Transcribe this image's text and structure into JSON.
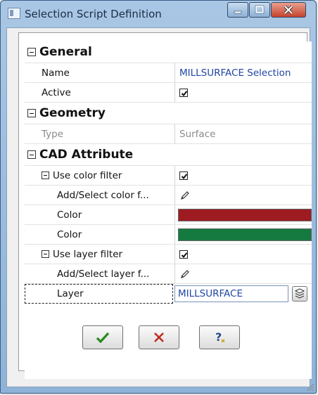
{
  "window": {
    "title": "Selection Script Definition"
  },
  "grid": {
    "rows": [
      {
        "label": "General",
        "kind": "category"
      },
      {
        "label": "Name",
        "value": "MILLSURFACE Selection",
        "kind": "text-link"
      },
      {
        "label": "Active",
        "value": true,
        "kind": "checkbox"
      },
      {
        "label": "Geometry",
        "kind": "category"
      },
      {
        "label": "Type",
        "value": "Surface",
        "kind": "text-grey"
      },
      {
        "label": "CAD Attribute",
        "kind": "category"
      },
      {
        "label": "Use color filter",
        "value": true,
        "kind": "checkbox-group"
      },
      {
        "label": "Add/Select color f...",
        "kind": "pencil"
      },
      {
        "label": "Color",
        "value": "#9e1b21",
        "kind": "color"
      },
      {
        "label": "Color",
        "value": "#157a3f",
        "kind": "color"
      },
      {
        "label": "Use layer filter",
        "value": true,
        "kind": "checkbox-group"
      },
      {
        "label": "Add/Select layer f...",
        "kind": "pencil"
      },
      {
        "label": "Layer",
        "value": "MILLSURFACE",
        "kind": "layer"
      }
    ]
  },
  "buttons": {
    "ok_icon": "check-icon",
    "cancel_icon": "cross-icon",
    "help_icon": "help-icon"
  },
  "colors": {
    "link": "#1f45a3",
    "ok": "#2a8a1f",
    "cancel": "#c22a22"
  }
}
